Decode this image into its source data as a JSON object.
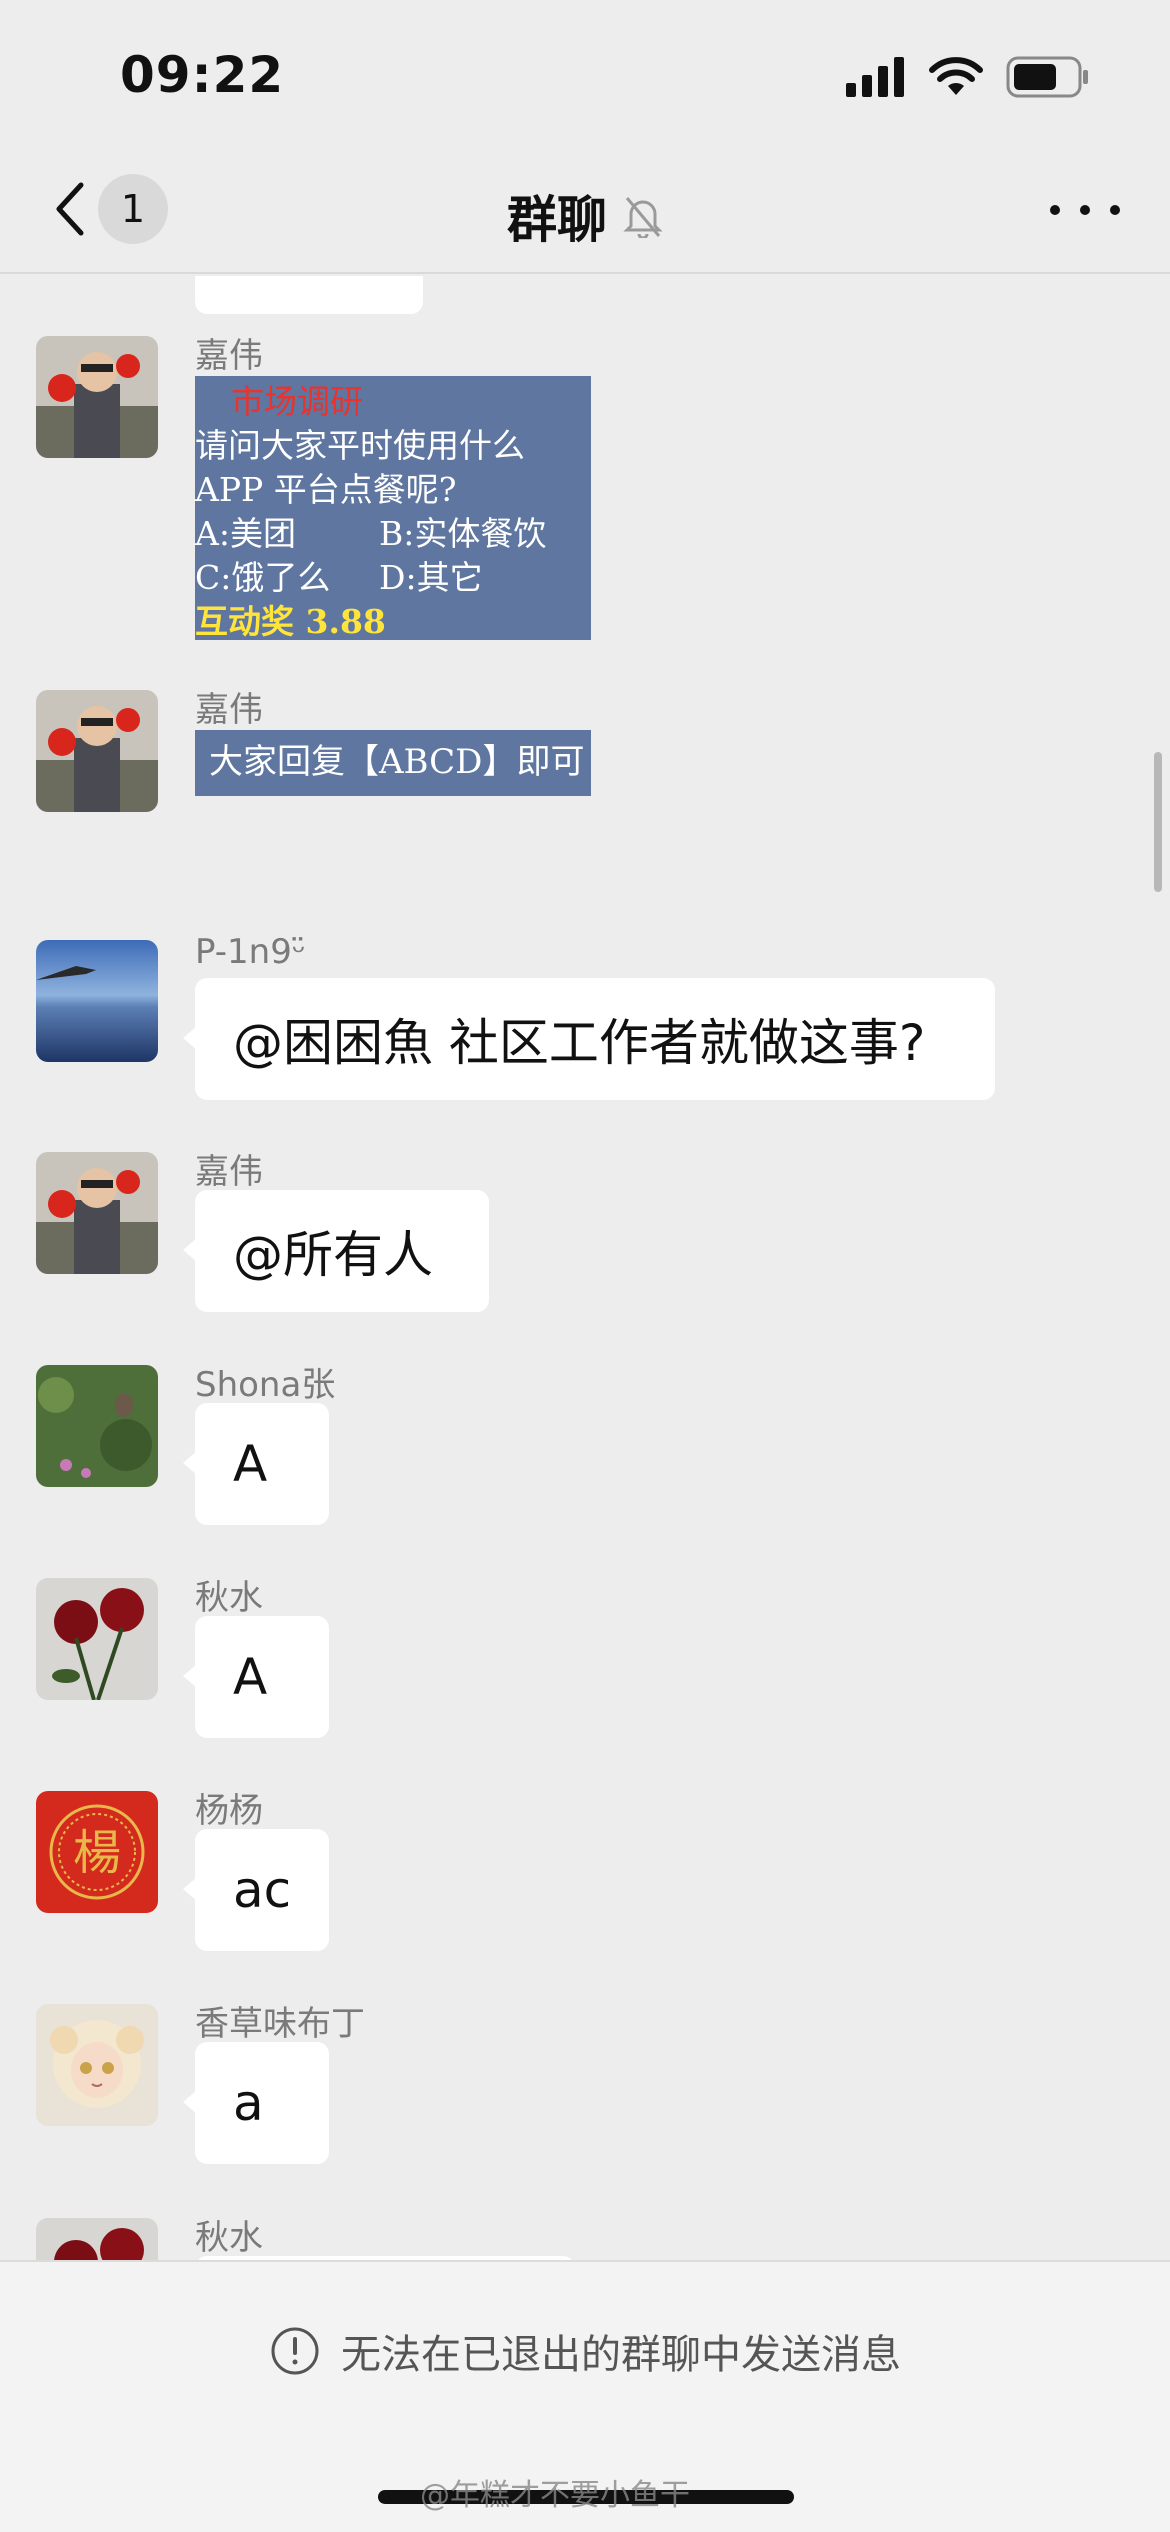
{
  "status_bar": {
    "time": "09:22"
  },
  "header": {
    "unread_count": "1",
    "title": "群聊"
  },
  "messages": [
    {
      "sender": "嘉伟",
      "type": "image",
      "card": {
        "title": "市场调研",
        "line1": "请问大家平时使用什么",
        "line2": "APP 平台点餐呢?",
        "opt_a": "A:美团",
        "opt_b": "B:实体餐饮",
        "opt_c": "C:饿了么",
        "opt_d": "D:其它",
        "reward": "互动奖 3.88"
      }
    },
    {
      "sender": "嘉伟",
      "type": "image",
      "card": {
        "text": "大家回复【ABCD】即可"
      }
    },
    {
      "sender": "P-1n9ᵕ̈",
      "text": "@困困魚 社区工作者就做这事?"
    },
    {
      "sender": "嘉伟",
      "text": "@所有人"
    },
    {
      "sender": "Shona张",
      "text": "A"
    },
    {
      "sender": "秋水",
      "text": "A"
    },
    {
      "sender": "杨杨",
      "text": "ac"
    },
    {
      "sender": "香草味布丁",
      "text": "a"
    },
    {
      "sender": "秋水",
      "text": ""
    }
  ],
  "footer": {
    "notice": "无法在已退出的群聊中发送消息",
    "watermark": "@年糕才不要小鱼干"
  },
  "colors": {
    "background": "#ededed",
    "bubble": "#ffffff",
    "card": "#5e76a0"
  }
}
